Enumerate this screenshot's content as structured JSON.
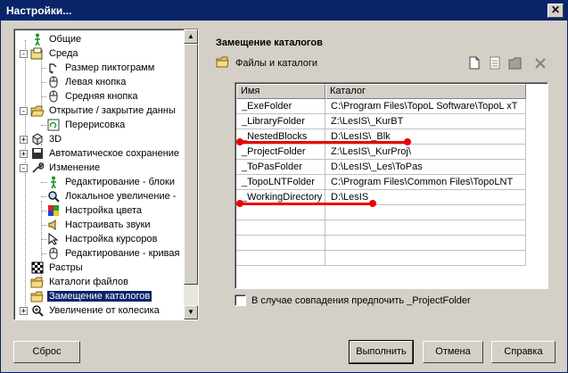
{
  "window": {
    "title": "Настройки...",
    "close_glyph": "✕"
  },
  "tree": {
    "items": [
      {
        "label": "Общие",
        "icon": "man-icon"
      },
      {
        "label": "Среда",
        "icon": "environment-icon"
      },
      {
        "label": "Размер пиктограмм",
        "icon": "icon-size-icon"
      },
      {
        "label": "Левая кнопка",
        "icon": "mouse-icon"
      },
      {
        "label": "Средняя кнопка",
        "icon": "mouse-icon"
      },
      {
        "label": "Открытие / закрытие данны",
        "icon": "folder-open-icon"
      },
      {
        "label": "Перерисовка",
        "icon": "redraw-icon"
      },
      {
        "label": "3D",
        "icon": "cube-icon"
      },
      {
        "label": "Автоматическое сохранение",
        "icon": "autosave-icon"
      },
      {
        "label": "Изменение",
        "icon": "wrench-icon"
      },
      {
        "label": "Редактирование - блоки",
        "icon": "man-icon"
      },
      {
        "label": "Локальное увеличение -",
        "icon": "magnifier-icon"
      },
      {
        "label": "Настройка цвета",
        "icon": "color-grid-icon"
      },
      {
        "label": "Настраивать звуки",
        "icon": "speaker-icon"
      },
      {
        "label": "Настройка курсоров",
        "icon": "cursor-icon"
      },
      {
        "label": "Редактирование - кривая",
        "icon": "mouse-icon"
      },
      {
        "label": "Растры",
        "icon": "raster-icon"
      },
      {
        "label": "Каталоги файлов",
        "icon": "folder-icon"
      },
      {
        "label": "Замещение каталогов",
        "icon": "folder-icon"
      },
      {
        "label": "Увеличение от колесика",
        "icon": "zoom-icon"
      }
    ],
    "scroll_up": "▲",
    "scroll_down": "▼"
  },
  "panel": {
    "title": "Замещение каталогов",
    "subtitle": "Файлы и каталоги",
    "columns": [
      "Имя",
      "Каталог"
    ],
    "rows": [
      [
        "_ExeFolder",
        "C:\\Program Files\\TopoL Software\\TopoL xT"
      ],
      [
        "_LibraryFolder",
        "Z:\\LesIS\\_KurBT"
      ],
      [
        "_NestedBlocks",
        "D:\\LesIS\\_Blk"
      ],
      [
        "_ProjectFolder",
        "Z:\\LesIS\\_KurProj\\"
      ],
      [
        "_ToPasFolder",
        "D:\\LesIS\\_Les\\ToPas"
      ],
      [
        "_TopoLNTFolder",
        "C:\\Program Files\\Common Files\\TopoLNT"
      ],
      [
        "_WorkingDirectory",
        "D:\\LesIS"
      ]
    ],
    "checkbox_label": "В случае совпадения предпочить _ProjectFolder"
  },
  "buttons": {
    "reset": "Сброс",
    "apply": "Выполнить",
    "cancel": "Отмена",
    "help": "Справка"
  },
  "colors": {
    "selection": "#0a246a",
    "annotation": "#e00000"
  }
}
